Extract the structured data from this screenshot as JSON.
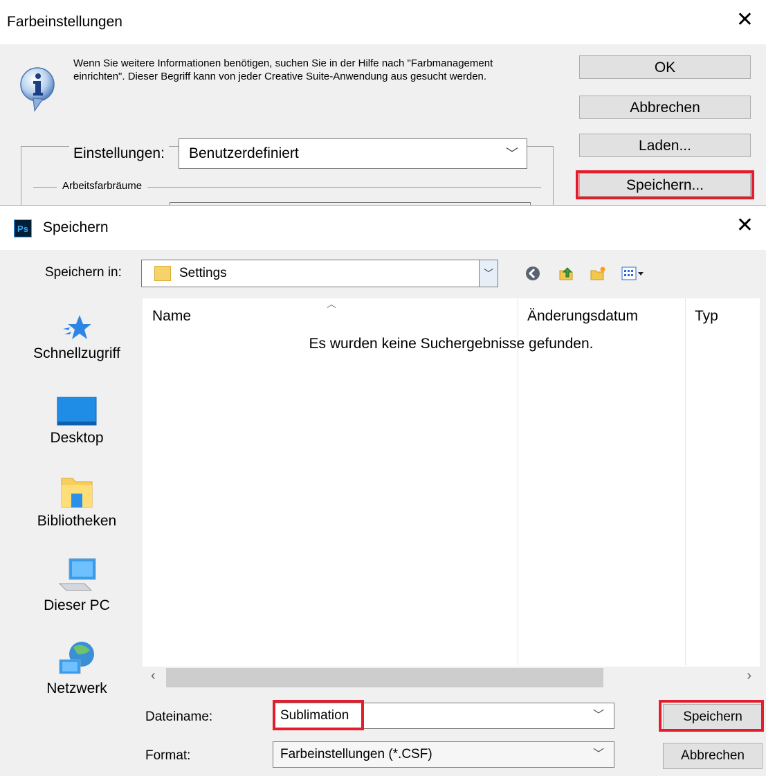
{
  "background_dialog": {
    "title": "Farbeinstellungen",
    "close_glyph": "✕",
    "info_text": "Wenn Sie weitere Informationen benötigen, suchen Sie in der Hilfe nach \"Farbmanagement einrichten\". Dieser Begriff kann von jeder Creative Suite-Anwendung aus gesucht werden.",
    "buttons": {
      "ok": "OK",
      "cancel": "Abbrechen",
      "load": "Laden...",
      "save": "Speichern..."
    },
    "settings_label": "Einstellungen:",
    "settings_value": "Benutzerdefiniert",
    "workspaces_label": "Arbeitsfarbräume"
  },
  "save_dialog": {
    "app_badge": "Ps",
    "title": "Speichern",
    "close_glyph": "✕",
    "save_in_label": "Speichern in:",
    "save_in_value": "Settings",
    "places": [
      "Schnellzugriff",
      "Desktop",
      "Bibliotheken",
      "Dieser PC",
      "Netzwerk"
    ],
    "columns": [
      "Name",
      "Änderungsdatum",
      "Typ"
    ],
    "empty_message": "Es wurden keine Suchergebnisse gefunden.",
    "filename_label": "Dateiname:",
    "filename_value": "Sublimation",
    "format_label": "Format:",
    "format_value": "Farbeinstellungen (*.CSF)",
    "save_button": "Speichern",
    "cancel_button": "Abbrechen"
  },
  "highlight_color": "#e31d2b"
}
